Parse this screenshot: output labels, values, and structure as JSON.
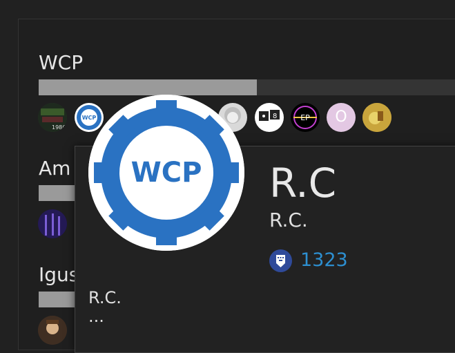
{
  "sections": [
    {
      "title": "WCP",
      "progress": 0.54
    },
    {
      "title": "Am",
      "progress": 0.09
    },
    {
      "title": "Igus",
      "progress": 0.09
    }
  ],
  "avatars_row1": [
    {
      "name": "avatar-1986",
      "text": "1986"
    },
    {
      "name": "avatar-wcp",
      "text": "WCP"
    },
    {
      "name": "avatar-anime-girl"
    },
    {
      "name": "avatar-dice",
      "text": "8"
    },
    {
      "name": "avatar-ep",
      "text": "EP"
    },
    {
      "name": "avatar-o",
      "text": "O"
    },
    {
      "name": "avatar-cartoon"
    }
  ],
  "user_card": {
    "avatar_text": "WCP",
    "display_name": "R.C",
    "username": "R.C.",
    "score": "1323",
    "bio": "R.C.",
    "more": "..."
  },
  "colors": {
    "accent_blue": "#2d8fd0",
    "wcp_blue": "#2a72c2",
    "badge_blue": "#2f4a9a"
  }
}
